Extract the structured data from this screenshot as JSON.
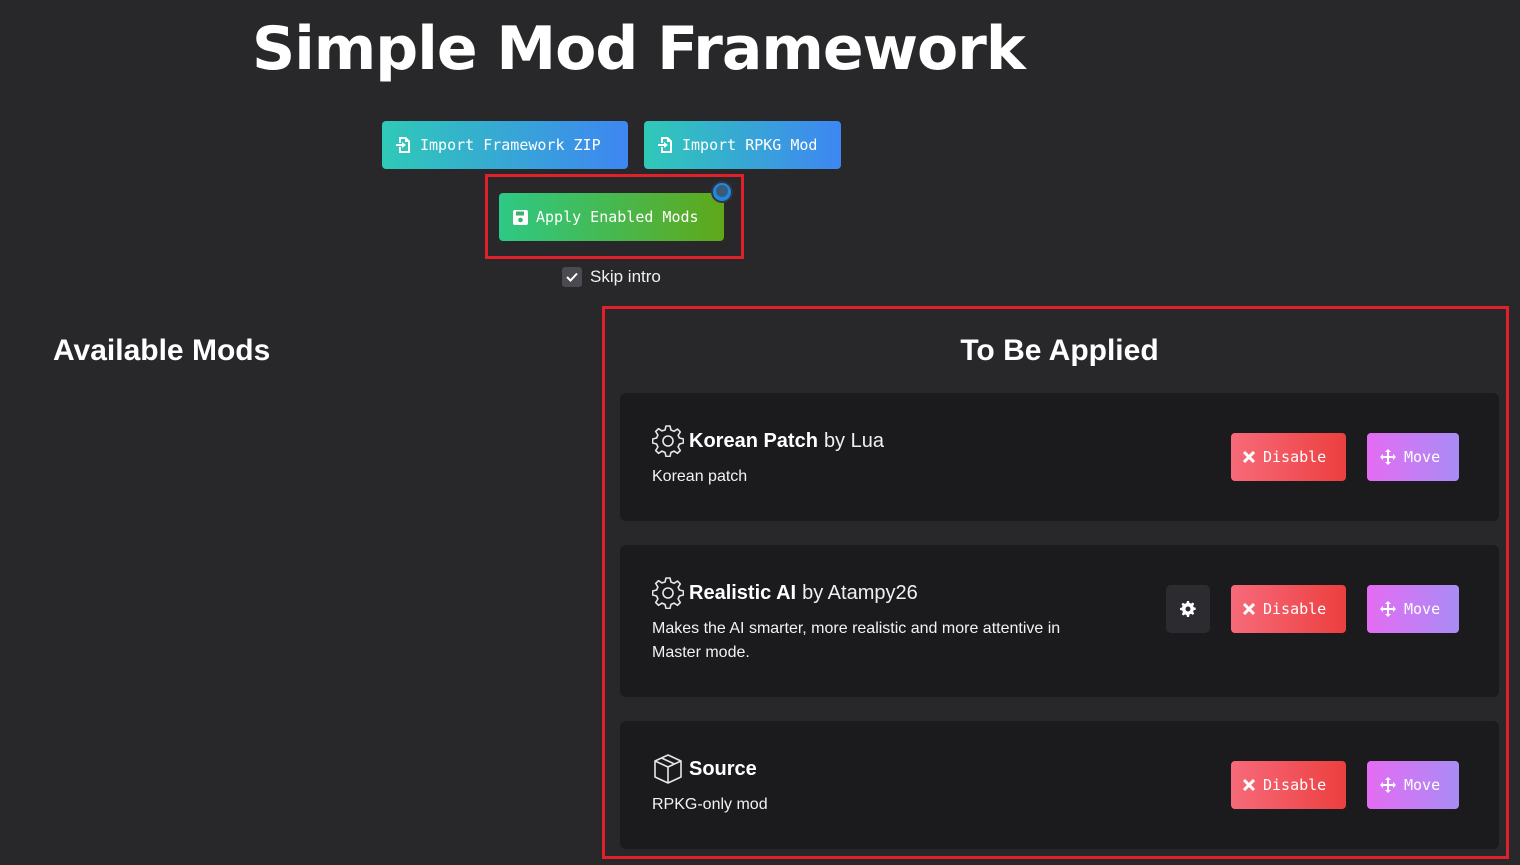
{
  "app": {
    "title": "Simple Mod Framework"
  },
  "toolbar": {
    "import_zip_label": "Import Framework ZIP",
    "import_rpkg_label": "Import RPKG Mod",
    "apply_label": "Apply Enabled Mods",
    "skip_intro_label": "Skip intro",
    "skip_intro_checked": true
  },
  "available": {
    "title": "Available Mods"
  },
  "applied": {
    "title": "To Be Applied",
    "mods": [
      {
        "name": "Korean Patch",
        "by": "by Lua",
        "description": "Korean patch",
        "icon": "gear-icon",
        "disable_label": "Disable",
        "move_label": "Move"
      },
      {
        "name": "Realistic AI",
        "by": "by Atampy26",
        "description": "Makes the AI smarter, more realistic and more attentive in Master mode.",
        "icon": "gear-icon",
        "has_settings": true,
        "disable_label": "Disable",
        "move_label": "Move"
      },
      {
        "name": "Source",
        "by": "",
        "description": "RPKG-only mod",
        "icon": "box-icon",
        "disable_label": "Disable",
        "move_label": "Move"
      }
    ]
  },
  "colors": {
    "background": "#28282b",
    "card": "#1b1b1e",
    "highlight": "#e0202a",
    "import_gradient": [
      "#2fc9b8",
      "#3e86f2"
    ],
    "apply_gradient": [
      "#2ec985",
      "#5fa81a"
    ],
    "disable_gradient": [
      "#f76a7a",
      "#ec3f3f"
    ],
    "move_gradient": [
      "#e46cf3",
      "#a98cf5"
    ]
  }
}
